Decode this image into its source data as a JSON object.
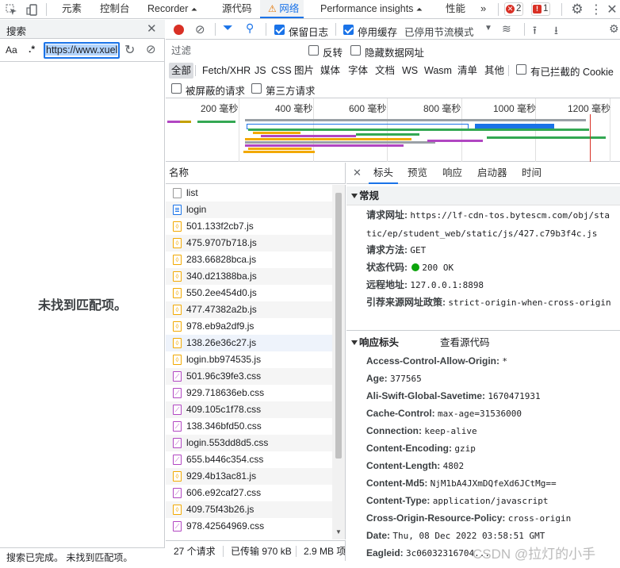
{
  "top_tabs": [
    "元素",
    "控制台",
    "Recorder",
    "源代码",
    "网络",
    "Performance insights",
    "性能"
  ],
  "errors": {
    "error_count": "2",
    "issue_count": "1"
  },
  "search_panel": {
    "title": "搜索",
    "case_label": "Aa",
    "regex_label": ".*",
    "query": "https://www.xuel",
    "empty_message": "未找到匹配项。",
    "status": "搜索已完成。  未找到匹配项。"
  },
  "toolbar": {
    "preserve_log": "保留日志",
    "disable_cache": "停用缓存",
    "throttling": "已停用节流模式"
  },
  "filter": {
    "placeholder": "过滤",
    "invert": "反转",
    "hide_data_urls": "隐藏数据网址",
    "types": [
      "全部",
      "Fetch/XHR",
      "JS",
      "CSS",
      "图片",
      "媒体",
      "字体",
      "文档",
      "WS",
      "Wasm",
      "清单",
      "其他"
    ],
    "blocked_cookies": "有已拦截的 Cookie",
    "blocked_requests": "被屏蔽的请求",
    "third_party": "第三方请求"
  },
  "overview": {
    "ticks": [
      "200 毫秒",
      "400 毫秒",
      "600 毫秒",
      "800 毫秒",
      "1000 毫秒",
      "1200 毫秒"
    ]
  },
  "request_list": {
    "header": "名称",
    "rows": [
      {
        "name": "list",
        "type": "blank"
      },
      {
        "name": "login",
        "type": "doc"
      },
      {
        "name": "501.133f2cb7.js",
        "type": "js"
      },
      {
        "name": "475.9707b718.js",
        "type": "js"
      },
      {
        "name": "283.66828bca.js",
        "type": "js"
      },
      {
        "name": "340.d21388ba.js",
        "type": "js"
      },
      {
        "name": "550.2ee454d0.js",
        "type": "js"
      },
      {
        "name": "477.47382a2b.js",
        "type": "js"
      },
      {
        "name": "978.eb9a2df9.js",
        "type": "js"
      },
      {
        "name": "138.26e36c27.js",
        "type": "js"
      },
      {
        "name": "login.bb974535.js",
        "type": "js"
      },
      {
        "name": "501.96c39fe3.css",
        "type": "css"
      },
      {
        "name": "929.718636eb.css",
        "type": "css"
      },
      {
        "name": "409.105c1f78.css",
        "type": "css"
      },
      {
        "name": "138.346bfd50.css",
        "type": "css"
      },
      {
        "name": "login.553dd8d5.css",
        "type": "css"
      },
      {
        "name": "655.b446c354.css",
        "type": "css"
      },
      {
        "name": "929.4b13ac81.js",
        "type": "js"
      },
      {
        "name": "606.e92caf27.css",
        "type": "css"
      },
      {
        "name": "409.75f43b26.js",
        "type": "js"
      },
      {
        "name": "978.42564969.css",
        "type": "css"
      }
    ],
    "footer": {
      "requests": "27 个请求",
      "transferred": "已传输 970 kB",
      "resources": "2.9 MB 项"
    }
  },
  "details": {
    "tabs": [
      "标头",
      "预览",
      "响应",
      "启动器",
      "时间"
    ],
    "general_title": "常规",
    "general": [
      {
        "k": "请求网址:",
        "v": "https://lf-cdn-tos.bytescm.com/obj/static/ep/student_web/static/js/427.c79b3f4c.js"
      },
      {
        "k": "请求方法:",
        "v": "GET"
      },
      {
        "k": "状态代码:",
        "v": "200 OK"
      },
      {
        "k": "远程地址:",
        "v": "127.0.0.1:8898"
      },
      {
        "k": "引荐来源网址政策:",
        "v": "strict-origin-when-cross-origin"
      }
    ],
    "response_title": "响应标头",
    "view_source": "查看源代码",
    "response": [
      {
        "k": "Access-Control-Allow-Origin:",
        "v": "*"
      },
      {
        "k": "Age:",
        "v": "377565"
      },
      {
        "k": "Ali-Swift-Global-Savetime:",
        "v": "1670471931"
      },
      {
        "k": "Cache-Control:",
        "v": "max-age=31536000"
      },
      {
        "k": "Connection:",
        "v": "keep-alive"
      },
      {
        "k": "Content-Encoding:",
        "v": "gzip"
      },
      {
        "k": "Content-Length:",
        "v": "4802"
      },
      {
        "k": "Content-Md5:",
        "v": "NjM1bA4JXmDQfeXd6JCtMg=="
      },
      {
        "k": "Content-Type:",
        "v": "application/javascript"
      },
      {
        "k": "Cross-Origin-Resource-Policy:",
        "v": "cross-origin"
      },
      {
        "k": "Date:",
        "v": "Thu, 08 Dec 2022 03:58:51 GMT"
      },
      {
        "k": "Eagleid:",
        "v": "3c06032316704..."
      }
    ]
  },
  "watermark": "CSDN @拉灯的小手"
}
